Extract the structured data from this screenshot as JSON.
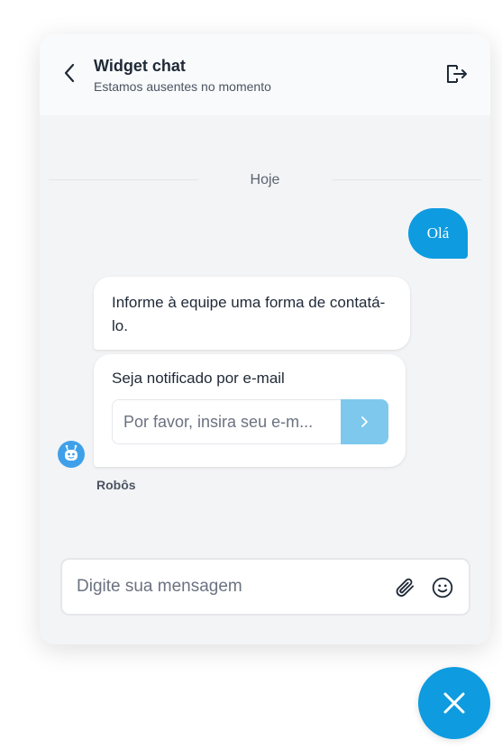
{
  "header": {
    "title": "Widget chat",
    "subtitle": "Estamos ausentes no momento",
    "back_icon": "chevron-left-icon",
    "exit_icon": "sign-out-icon"
  },
  "conversation": {
    "date_divider": "Hoje",
    "messages": [
      {
        "sender": "user",
        "text": "Olá"
      },
      {
        "sender": "bot",
        "text": "Informe à equipe uma forma de contatá-lo."
      }
    ],
    "email_capture": {
      "label": "Seja notificado por e-mail",
      "placeholder": "Por favor, insira seu e-m...",
      "submit_icon": "chevron-right-icon"
    },
    "bot_name": "Robôs",
    "bot_avatar_icon": "robot-icon"
  },
  "composer": {
    "placeholder": "Digite sua mensagem",
    "attach_icon": "paperclip-icon",
    "emoji_icon": "smiley-icon"
  },
  "launcher": {
    "close_icon": "close-icon"
  },
  "colors": {
    "accent": "#0e9be0",
    "submit_button": "#7ec8ee",
    "panel_background": "#f3f4f6",
    "bubble_background": "#ffffff"
  }
}
